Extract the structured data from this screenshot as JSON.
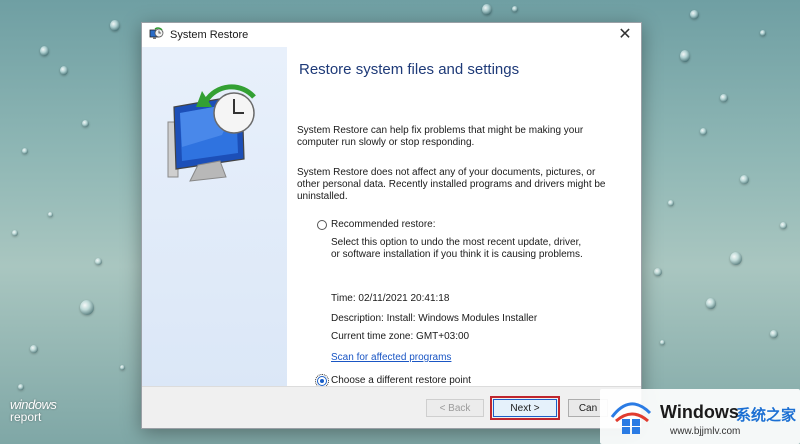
{
  "window": {
    "title": "System Restore",
    "close_glyph": "✕"
  },
  "content": {
    "heading": "Restore system files and settings",
    "para1": "System Restore can help fix problems that might be making your computer run slowly or stop responding.",
    "para2": "System Restore does not affect any of your documents, pictures, or other personal data. Recently installed programs and drivers might be uninstalled.",
    "recommended": {
      "label": "Recommended restore:",
      "checked": false,
      "description": "Select this option to undo the most recent update, driver, or software installation if you think it is causing problems.",
      "time": "Time: 02/11/2021 20:41:18",
      "description_line": "Description: Install: Windows Modules Installer",
      "timezone": "Current time zone: GMT+03:00",
      "scan_link": "Scan for affected programs"
    },
    "different": {
      "label": "Choose a different restore point",
      "checked": true
    }
  },
  "footer": {
    "back_label": "< Back",
    "next_label": "Next >",
    "cancel_label": "Can"
  },
  "watermark": {
    "line1": "windows",
    "line2": "report"
  },
  "badge": {
    "brand": "Windows",
    "brand_cn": "系统之家",
    "url": "www.bjjmlv.com"
  },
  "colors": {
    "heading": "#1e3a78",
    "link": "#1a56c4",
    "highlight_outline": "#c0262d"
  },
  "icons": [
    "system-restore-icon",
    "close-icon",
    "monitor-clock-icon",
    "radio-icon",
    "windows-logo-icon"
  ]
}
